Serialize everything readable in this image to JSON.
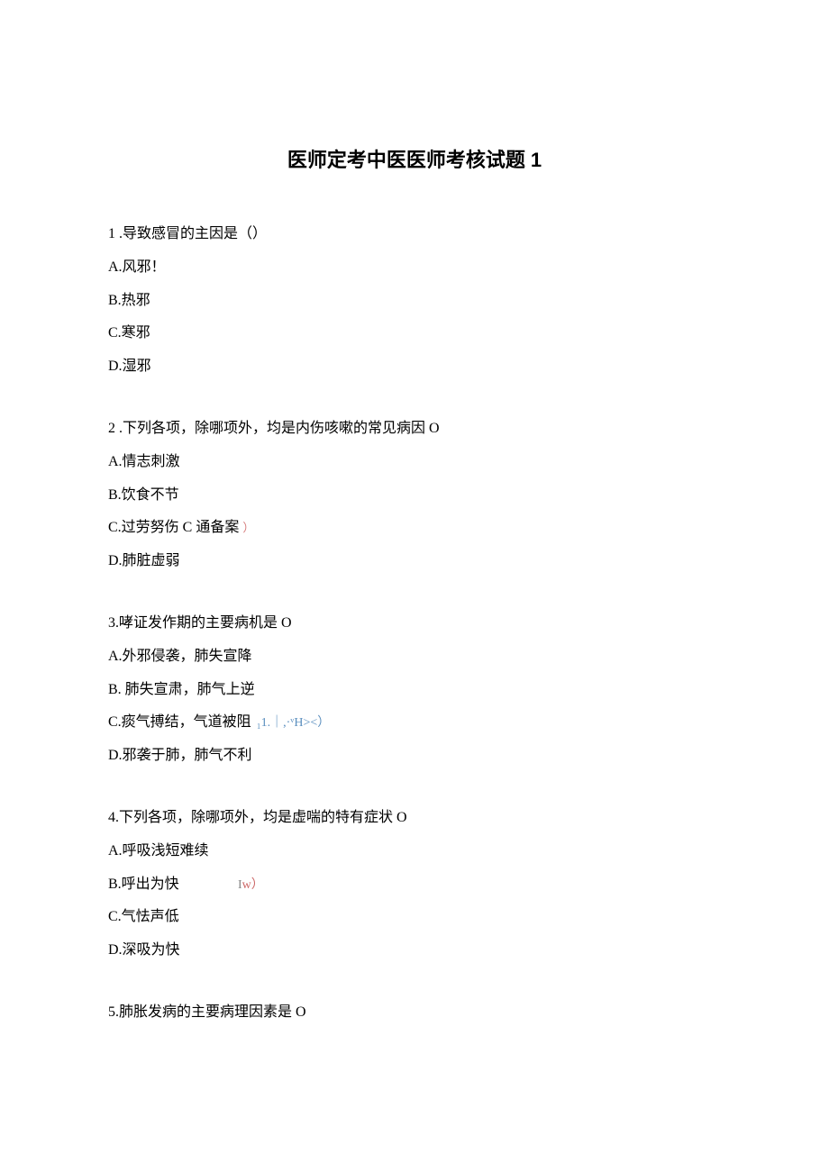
{
  "title": "医师定考中医医师考核试题 1",
  "q1": {
    "stem": "1 .导致感冒的主因是（）",
    "A": "A.风邪！",
    "B": "B.热邪",
    "C": "C.寒邪",
    "D": "D.湿邪"
  },
  "q2": {
    "stem": "2 .下列各项，除哪项外，均是内伤咳嗽的常见病因 O",
    "A": "A.情志刺激",
    "B": "B.饮食不节",
    "C_main": "C.过劳努伤 C 通备案",
    "C_anno": "）",
    "D": "D.肺脏虚弱"
  },
  "q3": {
    "stem": "3.哮证发作期的主要病机是 O",
    "A": "A.外邪侵袭，肺失宣降",
    "B": "B. 肺失宣肃，肺气上逆",
    "C_main": "C.痰气搏结，气道被阻 ",
    "C_anno": "₁1.｜,·ᵛH><）",
    "D": "D.邪袭于肺，肺气不利"
  },
  "q4": {
    "stem": "4.下列各项，除哪项外，均是虚喘的特有症状 O",
    "A": "A.呼吸浅短难续",
    "B_main": "B.呼出为快",
    "B_anno1": "I",
    "B_anno2": "w）",
    "C": "C.气怯声低",
    "D": "D.深吸为快"
  },
  "q5": {
    "stem": "5.肺胀发病的主要病理因素是 O"
  }
}
